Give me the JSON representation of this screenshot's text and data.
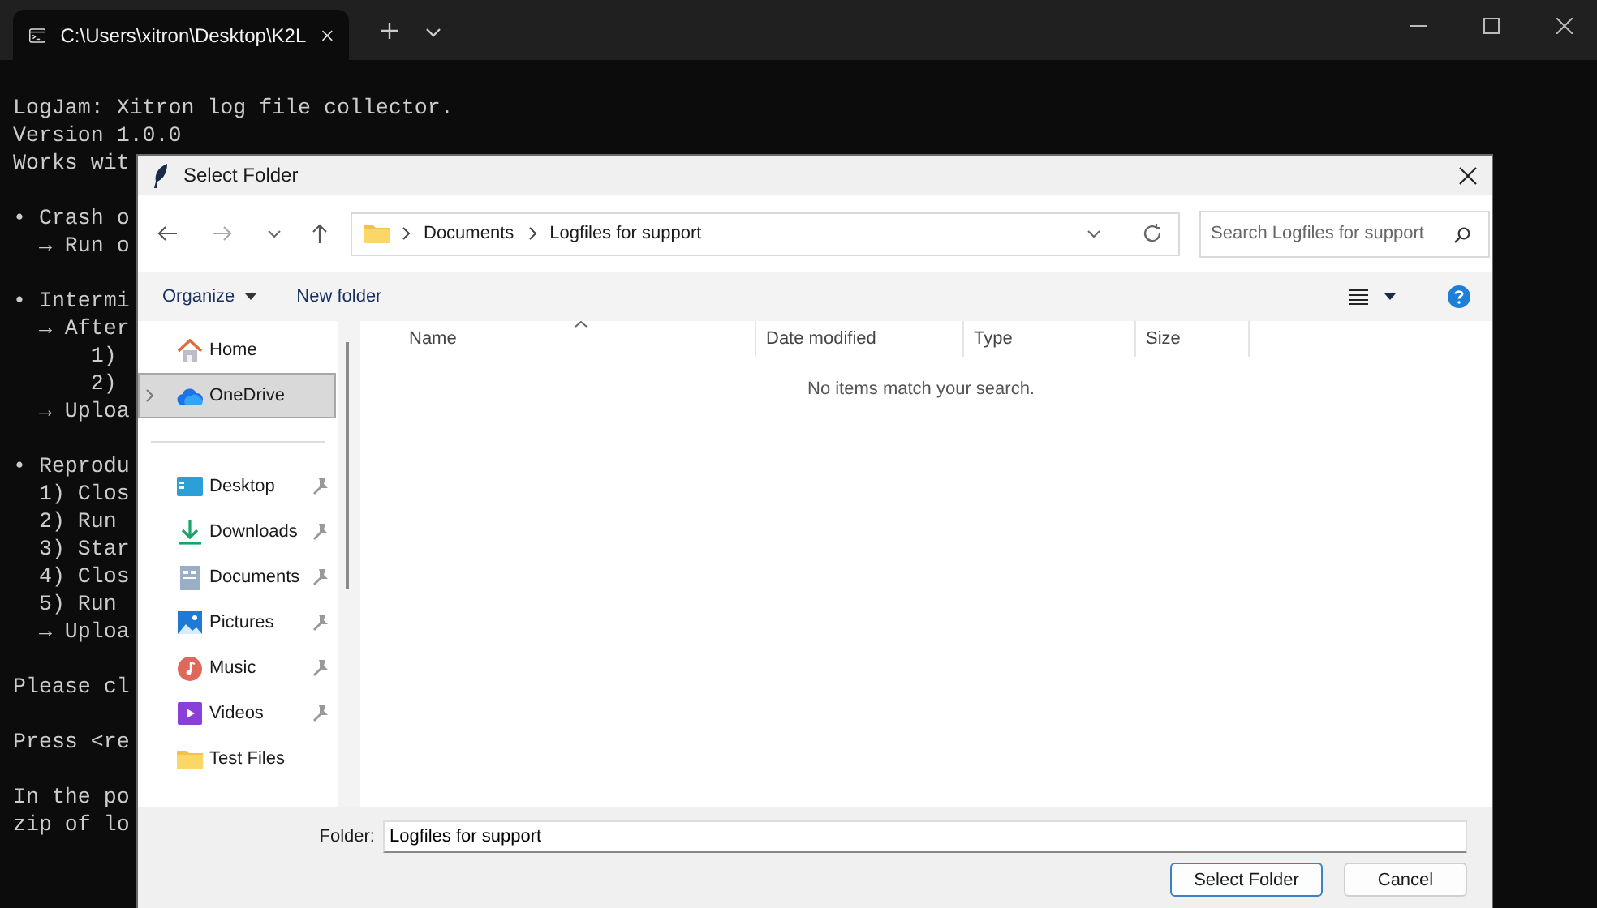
{
  "terminal": {
    "tab": {
      "title": "C:\\Users\\xitron\\Desktop\\K2L"
    },
    "blocks": [
      [
        "LogJam: Xitron log file collector.",
        "Version 1.0.0",
        "Works wit"
      ],
      [
        "• Crash o",
        "  → Run o"
      ],
      [
        "• Intermi",
        "  → After",
        "      1)",
        "      2)",
        "  → Uploa"
      ],
      [
        "• Reprodu",
        "  1) Clos",
        "  2) Run",
        "  3) Star",
        "  4) Clos",
        "  5) Run",
        "  → Uploa"
      ],
      [
        "Please cl"
      ],
      [
        "Press <re"
      ],
      [
        "In the po",
        "zip of lo"
      ]
    ]
  },
  "dialog": {
    "title": "Select Folder",
    "breadcrumb": [
      "Documents",
      "Logfiles for support"
    ],
    "search": {
      "placeholder": "Search Logfiles for support"
    },
    "toolbar": {
      "organize": "Organize",
      "new_folder": "New folder"
    },
    "sidebar": {
      "groups": [
        [
          {
            "label": "Home",
            "kind": "home",
            "selected": false,
            "pinned": false,
            "expandable": false
          },
          {
            "label": "OneDrive",
            "kind": "cloud",
            "selected": true,
            "pinned": false,
            "expandable": true
          }
        ],
        [
          {
            "label": "Desktop",
            "kind": "desktop",
            "selected": false,
            "pinned": true,
            "expandable": false
          },
          {
            "label": "Downloads",
            "kind": "download",
            "selected": false,
            "pinned": true,
            "expandable": false
          },
          {
            "label": "Documents",
            "kind": "document",
            "selected": false,
            "pinned": true,
            "expandable": false
          },
          {
            "label": "Pictures",
            "kind": "picture",
            "selected": false,
            "pinned": true,
            "expandable": false
          },
          {
            "label": "Music",
            "kind": "music",
            "selected": false,
            "pinned": true,
            "expandable": false
          },
          {
            "label": "Videos",
            "kind": "video",
            "selected": false,
            "pinned": true,
            "expandable": false
          },
          {
            "label": "Test Files",
            "kind": "folder",
            "selected": false,
            "pinned": false,
            "expandable": false
          }
        ]
      ]
    },
    "table": {
      "columns": [
        "Name",
        "Date modified",
        "Type",
        "Size"
      ],
      "empty_message": "No items match your search."
    },
    "folder_field": {
      "label": "Folder:",
      "value": "Logfiles for support"
    },
    "buttons": [
      {
        "label": "Select Folder",
        "default": true
      },
      {
        "label": "Cancel",
        "default": false
      }
    ]
  }
}
